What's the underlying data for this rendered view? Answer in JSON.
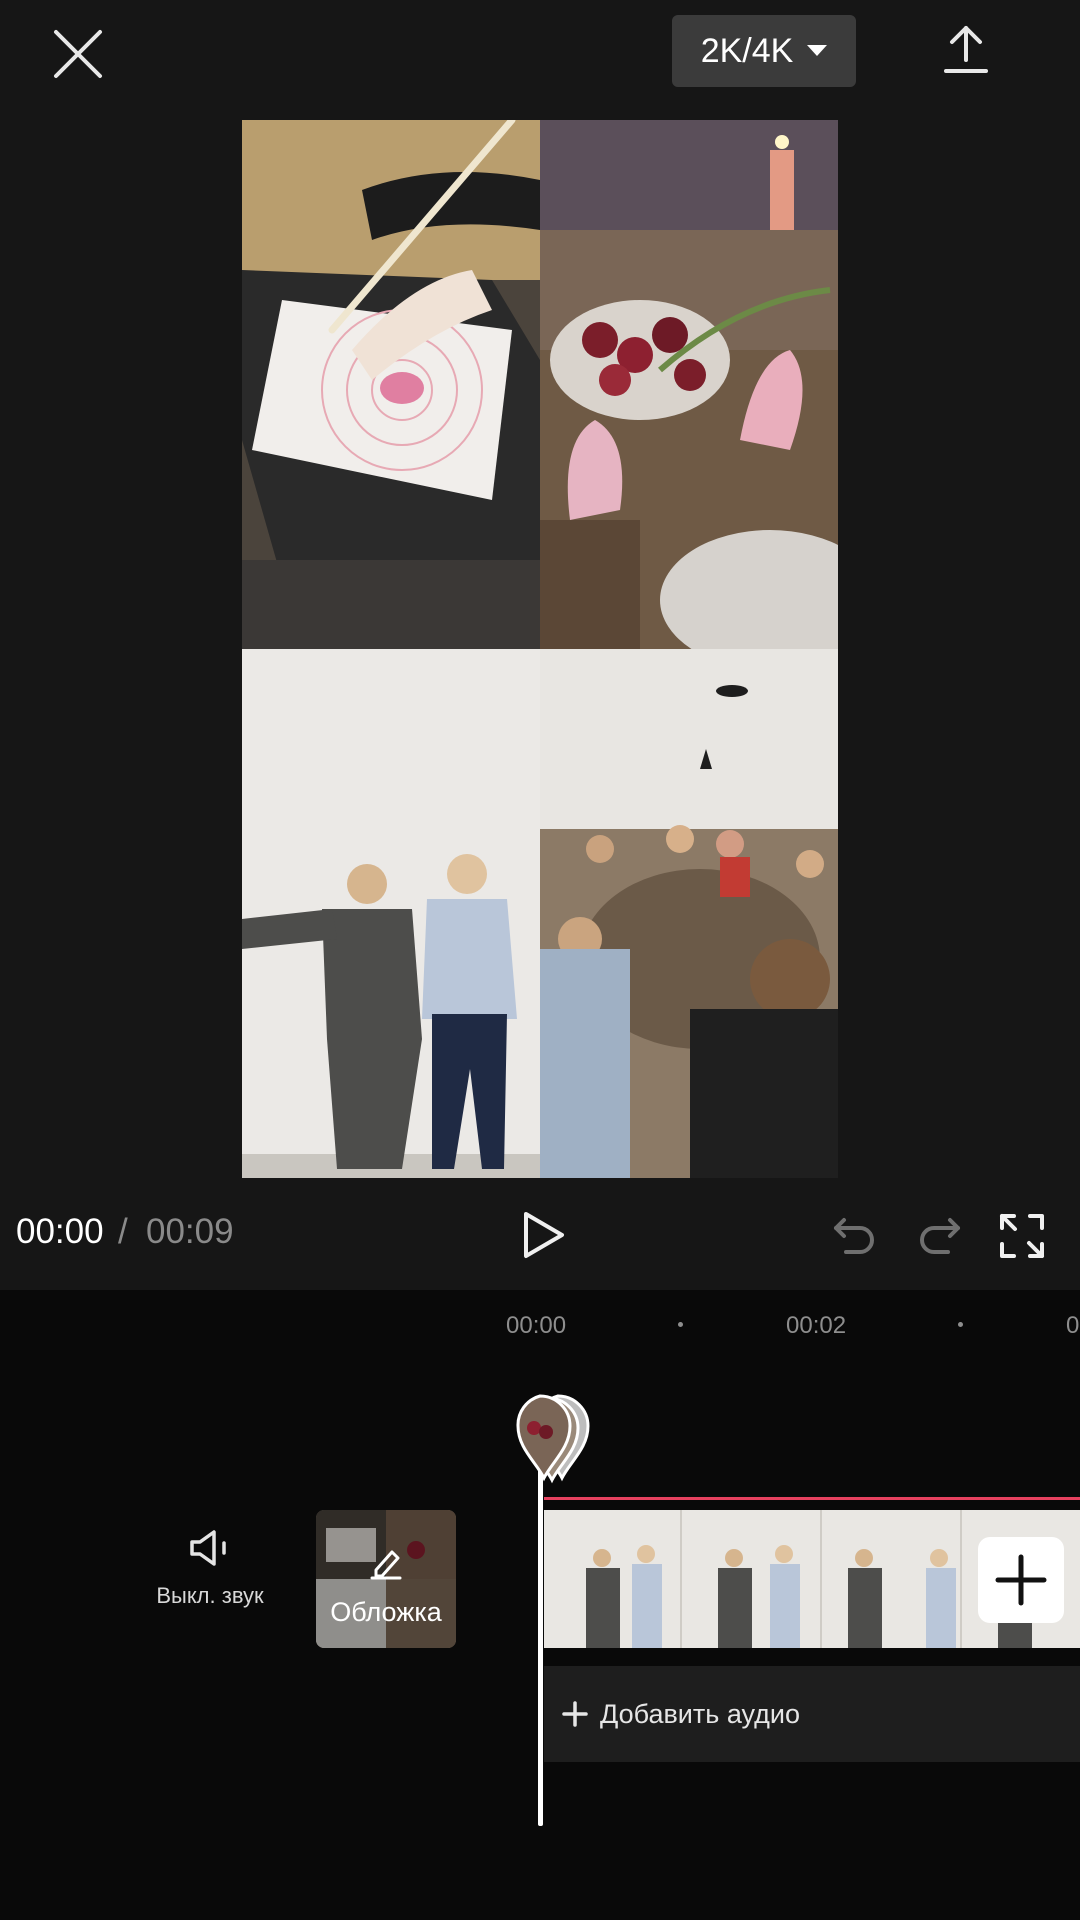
{
  "top_bar": {
    "resolution_label": "2K/4K",
    "icons": {
      "close": "close-icon",
      "resolution_dropdown": "caret-down-icon",
      "export": "upload-icon"
    }
  },
  "preview": {
    "tiles": [
      {
        "description_icon": "tablet-drawing-photo"
      },
      {
        "description_icon": "table-tulips-photo"
      },
      {
        "description_icon": "two-women-wall-photo"
      },
      {
        "description_icon": "dinner-party-photo"
      }
    ]
  },
  "playback": {
    "current_time": "00:00",
    "separator": "/",
    "total_time": "00:09",
    "icons": {
      "play": "play-icon",
      "undo": "undo-icon",
      "redo": "redo-icon",
      "fullscreen": "fullscreen-icon"
    }
  },
  "timeline": {
    "ruler": {
      "labels": [
        "00:00",
        "00:02",
        "0"
      ]
    },
    "mute_label": "Выкл. звук",
    "cover_label": "Обложка",
    "add_audio_label": "Добавить аудио",
    "colors": {
      "accent_line": "#e6415f",
      "background": "#090909"
    }
  }
}
